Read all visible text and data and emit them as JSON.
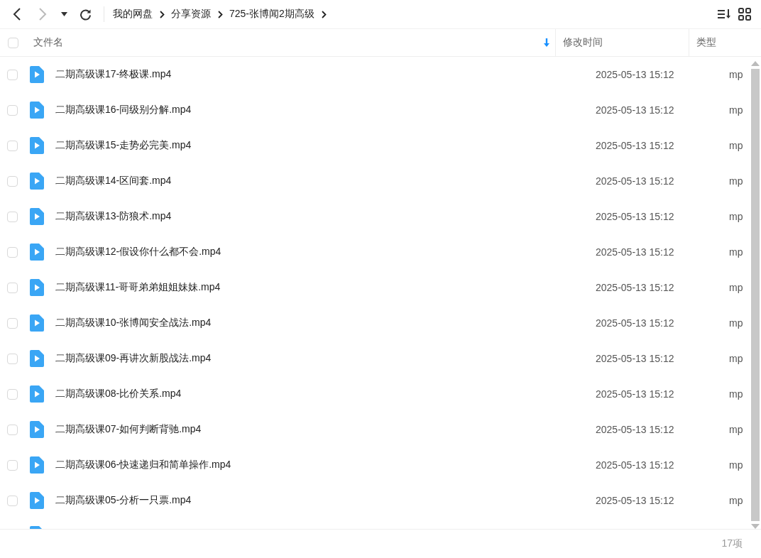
{
  "breadcrumb": [
    "我的网盘",
    "分享资源",
    "725-张博闻2期高级"
  ],
  "header": {
    "checked": false,
    "columns": [
      {
        "label": "文件名",
        "sorted": true
      },
      {
        "label": "修改时间",
        "sorted": false
      },
      {
        "label": "类型",
        "sorted": false
      }
    ]
  },
  "rows": [
    {
      "name": "二期高级课17-终极课.mp4",
      "modified": "2025-05-13 15:12",
      "type": "mp",
      "checked": false
    },
    {
      "name": "二期高级课16-同级别分解.mp4",
      "modified": "2025-05-13 15:12",
      "type": "mp",
      "checked": false
    },
    {
      "name": "二期高级课15-走势必完美.mp4",
      "modified": "2025-05-13 15:12",
      "type": "mp",
      "checked": false
    },
    {
      "name": "二期高级课14-区间套.mp4",
      "modified": "2025-05-13 15:12",
      "type": "mp",
      "checked": false
    },
    {
      "name": "二期高级课13-防狼术.mp4",
      "modified": "2025-05-13 15:12",
      "type": "mp",
      "checked": false
    },
    {
      "name": "二期高级课12-假设你什么都不会.mp4",
      "modified": "2025-05-13 15:12",
      "type": "mp",
      "checked": false
    },
    {
      "name": "二期高级课11-哥哥弟弟姐姐妹妹.mp4",
      "modified": "2025-05-13 15:12",
      "type": "mp",
      "checked": false
    },
    {
      "name": "二期高级课10-张博闻安全战法.mp4",
      "modified": "2025-05-13 15:12",
      "type": "mp",
      "checked": false
    },
    {
      "name": "二期高级课09-再讲次新股战法.mp4",
      "modified": "2025-05-13 15:12",
      "type": "mp",
      "checked": false
    },
    {
      "name": "二期高级课08-比价关系.mp4",
      "modified": "2025-05-13 15:12",
      "type": "mp",
      "checked": false
    },
    {
      "name": "二期高级课07-如何判断背驰.mp4",
      "modified": "2025-05-13 15:12",
      "type": "mp",
      "checked": false
    },
    {
      "name": "二期高级课06-快速递归和简单操作.mp4",
      "modified": "2025-05-13 15:12",
      "type": "mp",
      "checked": false
    },
    {
      "name": "二期高级课05-分析一只票.mp4",
      "modified": "2025-05-13 15:12",
      "type": "mp",
      "checked": false
    }
  ],
  "status_bar": {
    "count": "17项"
  }
}
